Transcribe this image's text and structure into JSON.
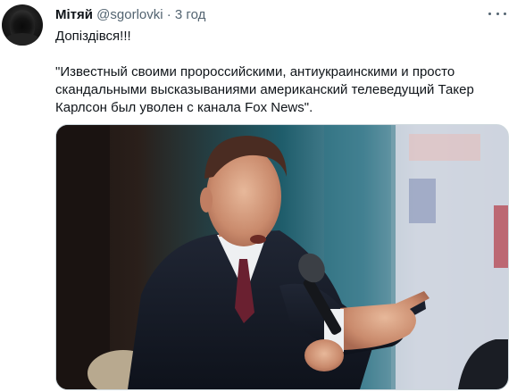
{
  "tweet": {
    "author_name": "Мітяй",
    "author_handle": "@sgorlovki",
    "separator": "·",
    "timestamp": "3 год",
    "text_line1": "Допіздівся!!!",
    "text_quote": "\"Известный своими пророссийскими, антиукраинскими и просто скандальными высказываниями американский телеведущий Такер Карлсон был уволен с канала Fox News\"."
  },
  "icons": {
    "avatar": "hooded-figure-avatar",
    "more": "more-options-icon"
  },
  "colors": {
    "text": "#0f1419",
    "secondary": "#536471",
    "background": "#ffffff"
  }
}
